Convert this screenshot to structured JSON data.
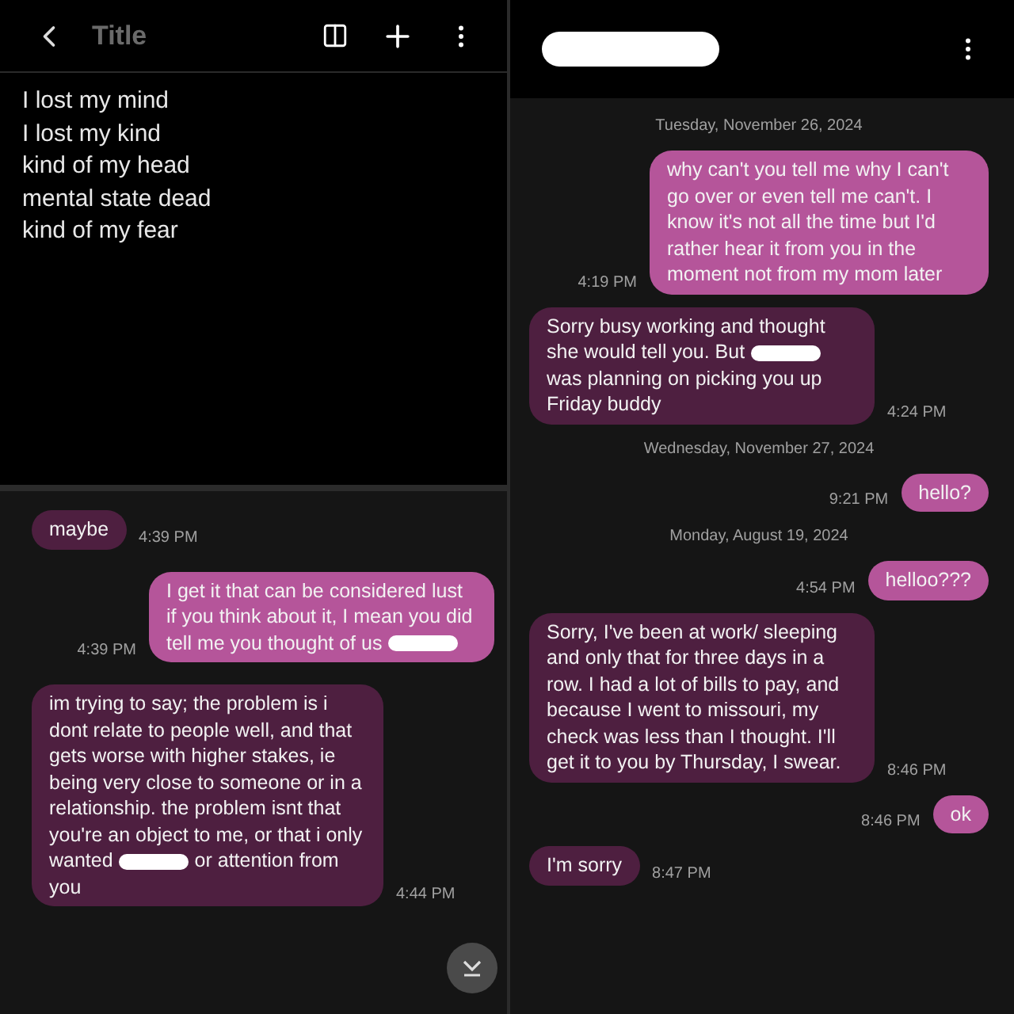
{
  "notes": {
    "title": "Title",
    "lines": [
      "I lost my mind",
      "I lost my kind",
      "kind of my head",
      "mental state dead",
      "kind of my fear"
    ]
  },
  "chat_left": [
    {
      "kind": "received",
      "time": "4:39 PM",
      "segments": [
        {
          "kind": "text",
          "text": "maybe"
        }
      ]
    },
    {
      "kind": "sent",
      "time": "4:39 PM",
      "segments": [
        {
          "kind": "text",
          "text": "I get it that can be considered lust if you think about it, I mean you did tell me you thought of us"
        },
        {
          "kind": "redaction"
        }
      ]
    },
    {
      "kind": "received",
      "time": "4:44 PM",
      "segments": [
        {
          "kind": "text",
          "text": "im trying to say; the problem is i dont relate to people well, and that gets worse with higher stakes, ie being very close to someone or in a relationship. the problem isnt that you're an object to me, or that i only wanted"
        },
        {
          "kind": "redaction"
        },
        {
          "kind": "text",
          "text": "or attention from you"
        }
      ]
    }
  ],
  "contact": {
    "redacted": true
  },
  "chat_right": [
    {
      "kind": "date",
      "text": "Tuesday, November 26, 2024"
    },
    {
      "kind": "sent",
      "time": "4:19 PM",
      "segments": [
        {
          "kind": "text",
          "text": "why can't you tell me why I can't go over or even tell me can't. I know it's not all the time but I'd rather hear it from you in the moment not from my mom later"
        }
      ]
    },
    {
      "kind": "received",
      "time": "4:24 PM",
      "segments": [
        {
          "kind": "text",
          "text": "Sorry busy working and thought she would tell you. But"
        },
        {
          "kind": "redaction"
        },
        {
          "kind": "text",
          "text": "was planning on picking you up Friday buddy"
        }
      ]
    },
    {
      "kind": "date",
      "text": "Wednesday, November 27, 2024"
    },
    {
      "kind": "sent",
      "time": "9:21 PM",
      "segments": [
        {
          "kind": "text",
          "text": "hello?"
        }
      ]
    },
    {
      "kind": "date",
      "text": "Monday, August 19, 2024"
    },
    {
      "kind": "sent",
      "time": "4:54 PM",
      "segments": [
        {
          "kind": "text",
          "text": "helloo???"
        }
      ]
    },
    {
      "kind": "received",
      "time": "8:46 PM",
      "segments": [
        {
          "kind": "text",
          "text": "Sorry, I've been at work/ sleeping and only that for three days in a row. I had a lot of bills to pay, and because I went to missouri, my check was less than I thought. I'll get it to you by Thursday, I swear."
        }
      ]
    },
    {
      "kind": "sent",
      "time": "8:46 PM",
      "segments": [
        {
          "kind": "text",
          "text": "ok"
        }
      ]
    },
    {
      "kind": "received",
      "time": "8:47 PM",
      "segments": [
        {
          "kind": "text",
          "text": "I'm sorry"
        }
      ]
    }
  ]
}
